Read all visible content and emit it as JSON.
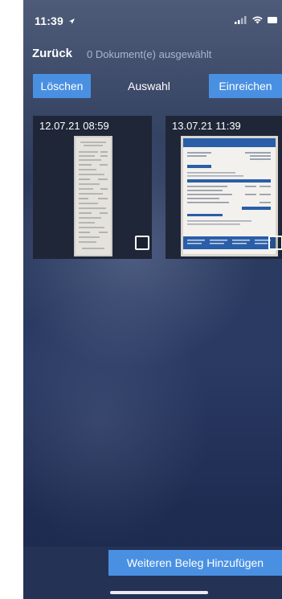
{
  "status_bar": {
    "time": "11:39",
    "location_icon": "location-arrow-icon",
    "icons": [
      "signal-icon",
      "wifi-icon",
      "battery-icon"
    ]
  },
  "nav": {
    "back_label": "Zurück",
    "selected_count": "0 Dokument(e) ausgewählt"
  },
  "toolbar": {
    "delete_label": "Löschen",
    "mode_label": "Auswahl",
    "submit_label": "Einreichen"
  },
  "documents": [
    {
      "date": "12.07.21 08:59",
      "selected": false,
      "type": "receipt"
    },
    {
      "date": "13.07.21 11:39",
      "selected": false,
      "type": "invoice",
      "heading": "Rechnung"
    }
  ],
  "footer": {
    "add_button_label": "Weiteren Beleg Hinzufügen"
  },
  "colors": {
    "accent": "#4a90e2",
    "background_top": "#4e5b78",
    "background_bottom": "#1e2a4f"
  }
}
